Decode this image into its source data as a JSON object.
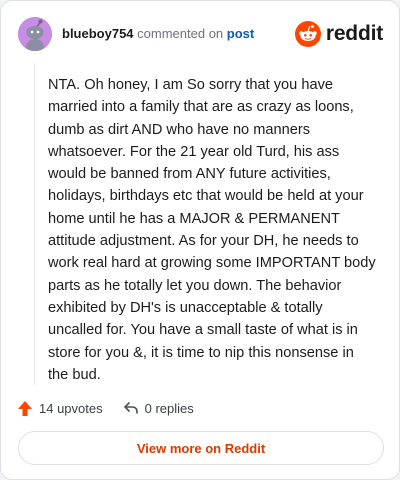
{
  "header": {
    "username": "blueboy754",
    "commented_on": "commented on",
    "post_link": "post",
    "brand": "reddit"
  },
  "comment": {
    "text": "NTA. Oh honey, I am So sorry that you have married into a family that are as crazy as loons, dumb as dirt AND who have no manners whatsoever. For the 21 year old Turd, his ass would be banned from ANY future activities, holidays, birthdays etc that would be held at your home until he has a MAJOR & PERMANENT attitude adjustment. As for your DH, he needs to work real hard at growing some IMPORTANT body parts as he totally let you down. The behavior exhibited by DH's is unacceptable & totally uncalled for. You have a small taste of what is in store for you &, it is time to nip this nonsense in the bud."
  },
  "actions": {
    "upvotes": "14 upvotes",
    "replies": "0 replies"
  },
  "footer": {
    "view_more": "View more on Reddit"
  },
  "colors": {
    "accent": "#ff4500",
    "link": "#0f5bb5",
    "avatar_bg": "#c78ce3"
  },
  "icons": {
    "avatar": "snoo-avatar-icon",
    "brand": "reddit-logo-icon",
    "upvote": "upvote-arrow-icon",
    "reply": "reply-arrow-icon"
  }
}
